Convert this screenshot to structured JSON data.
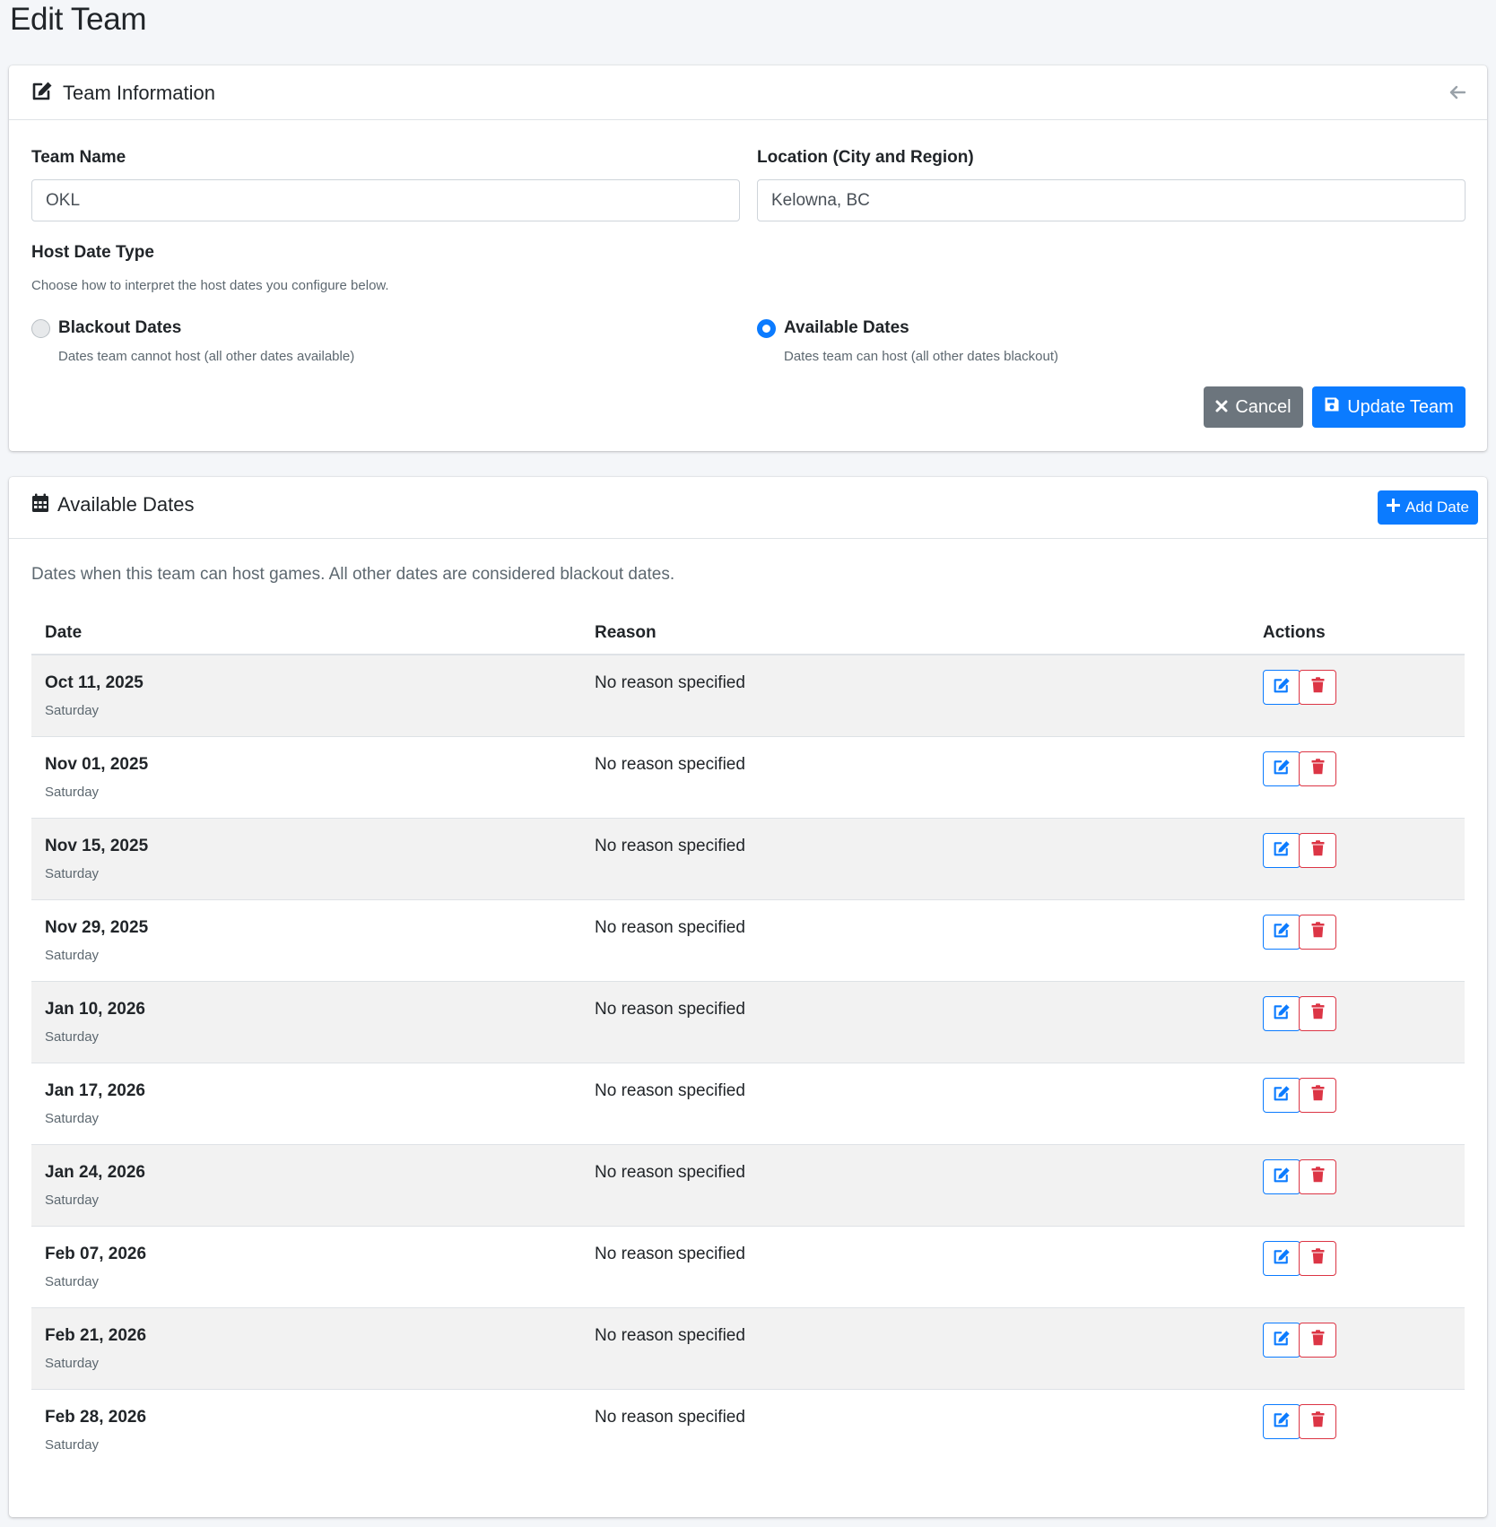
{
  "page": {
    "title": "Edit Team"
  },
  "team_info": {
    "header_title": "Team Information",
    "team_name_label": "Team Name",
    "team_name_value": "OKL",
    "location_label": "Location (City and Region)",
    "location_value": "Kelowna, BC",
    "host_date_type_label": "Host Date Type",
    "host_date_type_help": "Choose how to interpret the host dates you configure below.",
    "options": [
      {
        "label": "Blackout Dates",
        "description": "Dates team cannot host (all other dates available)",
        "checked": false
      },
      {
        "label": "Available Dates",
        "description": "Dates team can host (all other dates blackout)",
        "checked": true
      }
    ],
    "cancel_label": "Cancel",
    "update_label": "Update Team"
  },
  "available_dates": {
    "header_title": "Available Dates",
    "add_label": "Add Date",
    "description": "Dates when this team can host games. All other dates are considered blackout dates.",
    "columns": {
      "date": "Date",
      "reason": "Reason",
      "actions": "Actions"
    },
    "rows": [
      {
        "date": "Oct 11, 2025",
        "day": "Saturday",
        "reason": "No reason specified"
      },
      {
        "date": "Nov 01, 2025",
        "day": "Saturday",
        "reason": "No reason specified"
      },
      {
        "date": "Nov 15, 2025",
        "day": "Saturday",
        "reason": "No reason specified"
      },
      {
        "date": "Nov 29, 2025",
        "day": "Saturday",
        "reason": "No reason specified"
      },
      {
        "date": "Jan 10, 2026",
        "day": "Saturday",
        "reason": "No reason specified"
      },
      {
        "date": "Jan 17, 2026",
        "day": "Saturday",
        "reason": "No reason specified"
      },
      {
        "date": "Jan 24, 2026",
        "day": "Saturday",
        "reason": "No reason specified"
      },
      {
        "date": "Feb 07, 2026",
        "day": "Saturday",
        "reason": "No reason specified"
      },
      {
        "date": "Feb 21, 2026",
        "day": "Saturday",
        "reason": "No reason specified"
      },
      {
        "date": "Feb 28, 2026",
        "day": "Saturday",
        "reason": "No reason specified"
      }
    ]
  },
  "icons": {
    "team_info_header": "edit-icon",
    "back": "arrow-left-icon",
    "dates_header": "calendar-icon",
    "cancel": "times-icon",
    "update": "save-icon",
    "add": "plus-icon",
    "row_edit": "edit-icon",
    "row_delete": "trash-icon"
  },
  "colors": {
    "primary": "#0b7bff",
    "secondary": "#6c757d",
    "danger": "#dc3545",
    "background": "#f4f6f9"
  }
}
